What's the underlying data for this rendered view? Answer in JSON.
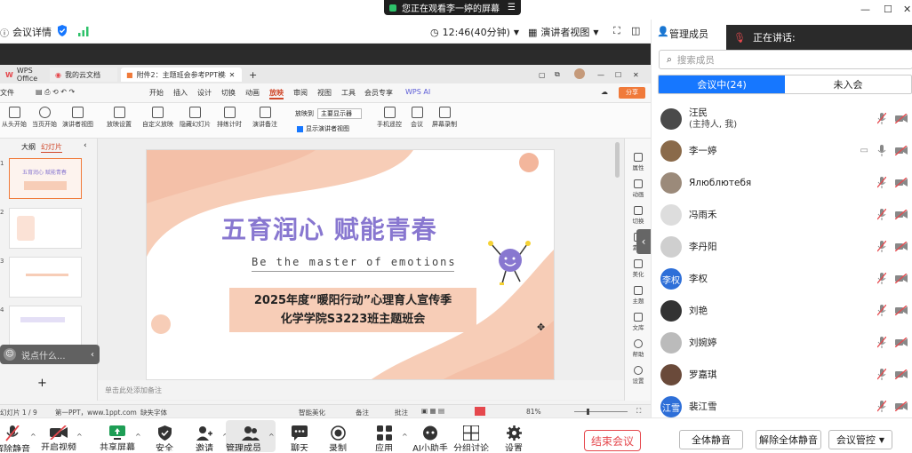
{
  "window": {
    "sharing_banner": "您正在观看李一婷的屏幕",
    "minimize": "—",
    "maximize": "☐",
    "close": "✕"
  },
  "meeting_toolbar": {
    "details": "会议详情",
    "time": "12:46(40分钟)",
    "view": "演讲者视图"
  },
  "wps": {
    "tabs": [
      {
        "label": "WPS Office"
      },
      {
        "label": "我的云文档"
      },
      {
        "label": "附件2：主题班会参考PPT模板"
      }
    ],
    "menus": [
      "开始",
      "插入",
      "设计",
      "切换",
      "动画",
      "放映",
      "审阅",
      "视图",
      "工具",
      "会员专享",
      "WPS AI"
    ],
    "file_menu": "文件",
    "share": "分享",
    "ribbon": [
      "从头开始",
      "当页开始",
      "演讲者视图",
      "放映设置",
      "自定义放映",
      "隐藏幻灯片",
      "排练计时",
      "演讲备注",
      "手机遥控",
      "会议",
      "屏幕录制"
    ],
    "ribbon_side": {
      "label": "放映到",
      "select": "主要显示器",
      "check": "显示演讲者视图"
    },
    "panel_tabs": [
      "大纲",
      "幻灯片"
    ],
    "thumb_numbers": [
      "1",
      "2",
      "3",
      "4"
    ],
    "slide": {
      "title": "五育润心  赋能青春",
      "subtitle": "Be the master of emotions",
      "line1": "2025年度“暖阳行动”心理育人宣传季",
      "line2": "化学学院S3223班主题班会"
    },
    "side_tools": [
      "属性",
      "动画",
      "切换",
      "素材",
      "美化",
      "主题",
      "文库",
      "帮助",
      "设置"
    ],
    "notes_placeholder": "单击此处添加备注",
    "status": {
      "page": "幻灯片 1 / 9",
      "template": "第一PPT，www.1ppt.com",
      "font": "缺失字体",
      "beautify": "智能美化",
      "notes": "备注",
      "comments": "批注",
      "zoom": "81%"
    },
    "speak_placeholder": "说点什么..."
  },
  "bottom_toolbar": [
    {
      "label": "解除静音",
      "icon": "mic-off-icon"
    },
    {
      "label": "开启视频",
      "icon": "video-off-icon"
    },
    {
      "label": "共享屏幕",
      "icon": "share-screen-icon"
    },
    {
      "label": "安全",
      "icon": "shield-icon"
    },
    {
      "label": "邀请",
      "icon": "invite-icon"
    },
    {
      "label": "管理成员(24)",
      "icon": "members-icon"
    },
    {
      "label": "聊天",
      "icon": "chat-icon"
    },
    {
      "label": "录制",
      "icon": "record-icon"
    },
    {
      "label": "应用",
      "icon": "apps-icon"
    },
    {
      "label": "AI小助手",
      "icon": "ai-icon"
    },
    {
      "label": "分组讨论",
      "icon": "breakout-icon"
    },
    {
      "label": "设置",
      "icon": "gear-icon"
    }
  ],
  "end_meeting": "结束会议",
  "members_panel": {
    "title": "管理成员",
    "speaking": "正在讲话:",
    "search_placeholder": "搜索成员",
    "tab_in": "会议中(24)",
    "tab_out": "未入会",
    "members": [
      {
        "name": "汪民",
        "sub": "(主持人, 我)",
        "avatar_text": "",
        "color": "#4a4a4a"
      },
      {
        "name": "李一婷",
        "sub": "",
        "avatar_text": "",
        "color": "#8a6a4a"
      },
      {
        "name": "Ялюблютебя",
        "sub": "",
        "avatar_text": "",
        "color": "#9b8a7a"
      },
      {
        "name": "冯雨禾",
        "sub": "",
        "avatar_text": "",
        "color": "#dddddd"
      },
      {
        "name": "李丹阳",
        "sub": "",
        "avatar_text": "",
        "color": "#cfcfcf"
      },
      {
        "name": "李权",
        "sub": "",
        "avatar_text": "李权",
        "color": "#2e6fd8"
      },
      {
        "name": "刘艳",
        "sub": "",
        "avatar_text": "",
        "color": "#333333"
      },
      {
        "name": "刘婉婷",
        "sub": "",
        "avatar_text": "",
        "color": "#bbbbbb"
      },
      {
        "name": "罗嘉琪",
        "sub": "",
        "avatar_text": "",
        "color": "#6a4a3a"
      },
      {
        "name": "裴江雪",
        "sub": "",
        "avatar_text": "江雪",
        "color": "#2e6fd8"
      }
    ],
    "mute_all": "全体静音",
    "unmute_all": "解除全体静音",
    "meeting_control": "会议管控"
  }
}
